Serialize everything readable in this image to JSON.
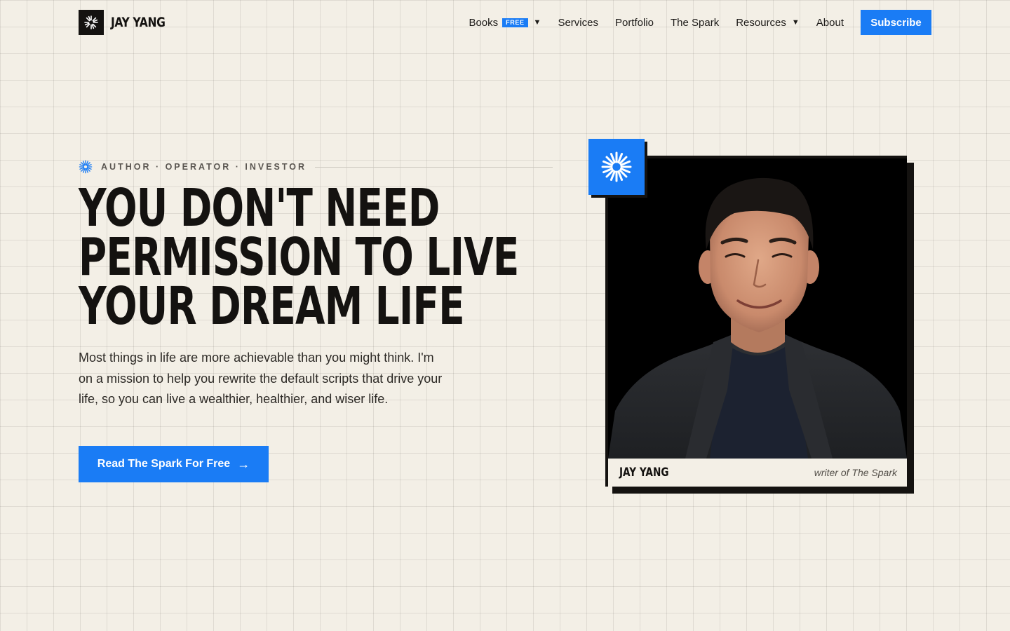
{
  "nav": {
    "brand": "JAY YANG",
    "items": [
      {
        "label": "Books",
        "badge": "FREE",
        "dropdown": true
      },
      {
        "label": "Services"
      },
      {
        "label": "Portfolio"
      },
      {
        "label": "The Spark"
      },
      {
        "label": "Resources",
        "dropdown": true
      },
      {
        "label": "About"
      }
    ],
    "subscribe_label": "Subscribe"
  },
  "hero": {
    "eyebrow": "AUTHOR · OPERATOR · INVESTOR",
    "headline": [
      "YOU DON'T NEED",
      "PERMISSION TO LIVE",
      "YOUR DREAM LIFE"
    ],
    "lede": "Most things in life are more achievable than you might think. I'm on a mission to help you rewrite the default scripts that drive your life, so you can live a wealthier, healthier, and wiser life.",
    "cta_label": "Read The Spark For Free",
    "cta_arrow": "→"
  },
  "card": {
    "name": "JAY YANG",
    "role": "writer of The Spark"
  },
  "icons": {
    "brand": "spark-icon",
    "dropdown": "caret-down-icon",
    "cta": "arrow-right-icon"
  },
  "colors": {
    "accent": "#1a7cf5",
    "ink": "#141210",
    "paper": "#f3efe6"
  }
}
